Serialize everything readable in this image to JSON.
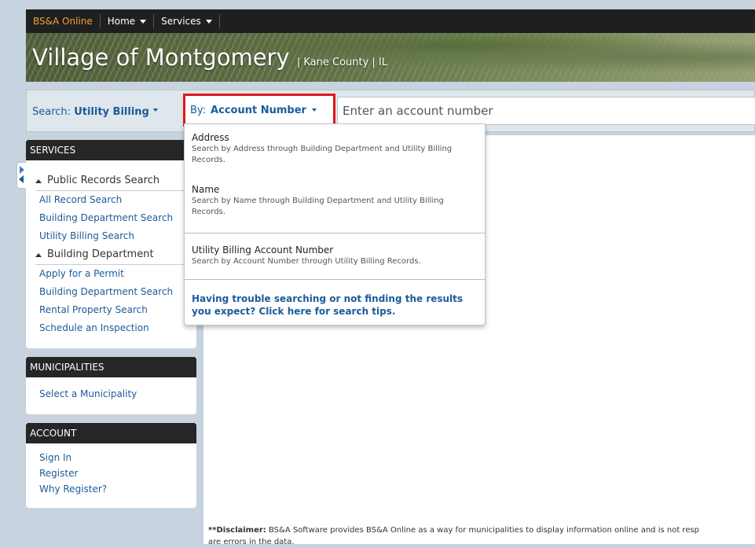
{
  "topbar": {
    "brand": "BS&A Online",
    "nav": [
      {
        "label": "Home",
        "icon": "caret-down-icon"
      },
      {
        "label": "Services",
        "icon": "caret-down-icon"
      }
    ]
  },
  "banner": {
    "title": "Village of Montgomery",
    "subtitle": "| Kane County | IL"
  },
  "search": {
    "label": "Search:",
    "type": "Utility Billing",
    "by_label": "By:",
    "by_value": "Account Number",
    "placeholder": "Enter an account number"
  },
  "dropdown": {
    "items": [
      {
        "title": "Address",
        "desc": "Search by Address through Building Department and Utility Billing Records."
      },
      {
        "title": "Name",
        "desc": "Search by Name through Building Department and Utility Billing Records."
      },
      {
        "title": "Utility Billing Account Number",
        "desc": "Search by Account Number through Utility Billing Records."
      }
    ],
    "tips": "Having trouble searching or not finding the results you expect? Click here for search tips."
  },
  "sidebar": {
    "services": {
      "header": "SERVICES",
      "groups": [
        {
          "label": "Public Records Search",
          "links": [
            "All Record Search",
            "Building Department Search",
            "Utility Billing Search"
          ]
        },
        {
          "label": "Building Department",
          "links": [
            "Apply for a Permit",
            "Building Department Search",
            "Rental Property Search",
            "Schedule an Inspection"
          ]
        }
      ]
    },
    "municipalities": {
      "header": "MUNICIPALITIES",
      "links": [
        "Select a Municipality"
      ]
    },
    "account": {
      "header": "ACCOUNT",
      "links": [
        "Sign In",
        "Register",
        "Why Register?"
      ]
    }
  },
  "disclaimer": {
    "bold": "**Disclaimer:",
    "text": " BS&A Software provides BS&A Online as a way for municipalities to display information online and is not resp",
    "line2": "are errors in the data."
  },
  "colors": {
    "accent": "#1b5b9a",
    "highlight": "#e0161c",
    "brand": "#f0a23a"
  }
}
